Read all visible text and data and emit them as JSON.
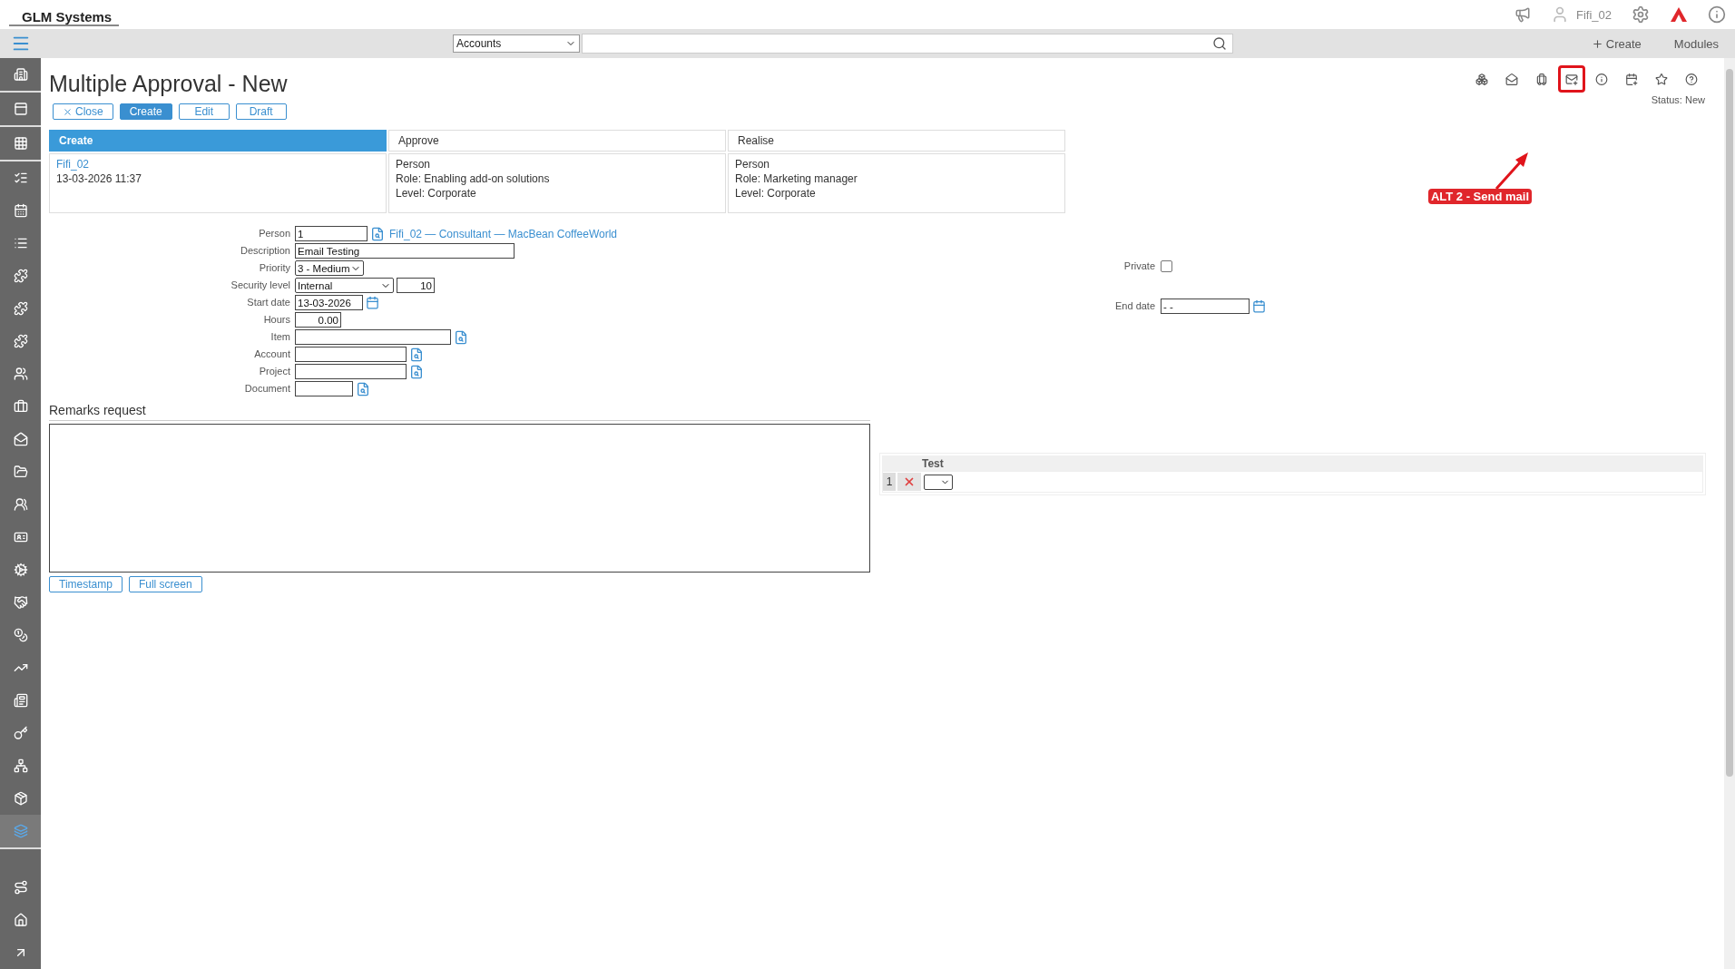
{
  "header": {
    "logo": "GLM Systems",
    "user": "Fifi_02"
  },
  "nav_bar": {
    "scope": "Accounts",
    "create": "Create",
    "modules": "Modules"
  },
  "sidebar": {
    "groups": [
      [
        {
          "selected": false
        }
      ],
      [
        {
          "selected": false
        }
      ],
      [
        {
          "selected": false
        }
      ],
      [
        {
          "selected": false
        },
        {
          "selected": false
        },
        {
          "selected": false
        },
        {
          "selected": false
        },
        {
          "selected": false
        },
        {
          "selected": false
        },
        {
          "selected": false
        },
        {
          "selected": false
        },
        {
          "selected": false
        },
        {
          "selected": false
        },
        {
          "selected": false
        },
        {
          "selected": false
        },
        {
          "selected": false
        },
        {
          "selected": false
        },
        {
          "selected": false
        },
        {
          "selected": false
        },
        {
          "selected": false
        },
        {
          "selected": false
        },
        {
          "selected": false
        },
        {
          "selected": false
        },
        {
          "selected": true
        }
      ],
      [
        {
          "selected": false
        },
        {
          "selected": false
        },
        {
          "selected": false
        }
      ]
    ]
  },
  "page": {
    "title": "Multiple Approval - New",
    "status": "Status: New"
  },
  "actions": [
    {
      "label": "Close",
      "kind": "close",
      "primary": false
    },
    {
      "label": "Create",
      "kind": "plain",
      "primary": true
    },
    {
      "label": "Edit",
      "kind": "plain",
      "primary": false
    },
    {
      "label": "Draft",
      "kind": "plain",
      "primary": false
    }
  ],
  "toolbar": [
    {
      "highlighted": false
    },
    {
      "highlighted": false
    },
    {
      "highlighted": false
    },
    {
      "highlighted": true
    },
    {
      "highlighted": false
    },
    {
      "highlighted": false
    },
    {
      "highlighted": false
    },
    {
      "highlighted": false
    }
  ],
  "annotation": {
    "text": "ALT 2 - Send mail"
  },
  "workflow": [
    {
      "title": "Create",
      "selected": true,
      "lines": [
        {
          "text": "Fifi_02",
          "link": true
        },
        {
          "text": "13-03-2026 11:37",
          "link": false
        }
      ]
    },
    {
      "title": "Approve",
      "selected": false,
      "lines": [
        {
          "text": "Person",
          "link": false
        },
        {
          "text": "Role: Enabling add-on solutions",
          "link": false
        },
        {
          "text": "Level: Corporate",
          "link": false
        }
      ]
    },
    {
      "title": "Realise",
      "selected": false,
      "lines": [
        {
          "text": "Person",
          "link": false
        },
        {
          "text": "Role: Marketing manager",
          "link": false
        },
        {
          "text": "Level: Corporate",
          "link": false
        }
      ]
    }
  ],
  "form": {
    "fields": [
      {
        "label": "Person",
        "kind": "lookup",
        "value": "1",
        "link": "Fifi_02 — Consultant — MacBean CoffeeWorld"
      },
      {
        "label": "Description",
        "kind": "text",
        "value": "Email Testing"
      },
      {
        "label": "Priority",
        "kind": "select",
        "value": "3 - Medium"
      },
      {
        "label": "Security level",
        "kind": "select_number",
        "value": "Internal",
        "number": "10"
      },
      {
        "label": "Start date",
        "kind": "date",
        "value": "13-03-2026"
      },
      {
        "label": "Hours",
        "kind": "number",
        "value": "0.00"
      },
      {
        "label": "Item",
        "kind": "lookup_wide"
      },
      {
        "label": "Account",
        "kind": "lookup_mid"
      },
      {
        "label": "Project",
        "kind": "lookup_mid"
      },
      {
        "label": "Document",
        "kind": "lookup_small"
      }
    ],
    "private": {
      "label": "Private",
      "checked": false
    },
    "end_date": {
      "label": "End date",
      "value": "- -"
    }
  },
  "remarks": {
    "title": "Remarks request",
    "buttons": [
      "Timestamp",
      "Full screen"
    ]
  },
  "grid": {
    "columns": [
      "Test"
    ],
    "rows": [
      {
        "number": "1"
      }
    ]
  }
}
